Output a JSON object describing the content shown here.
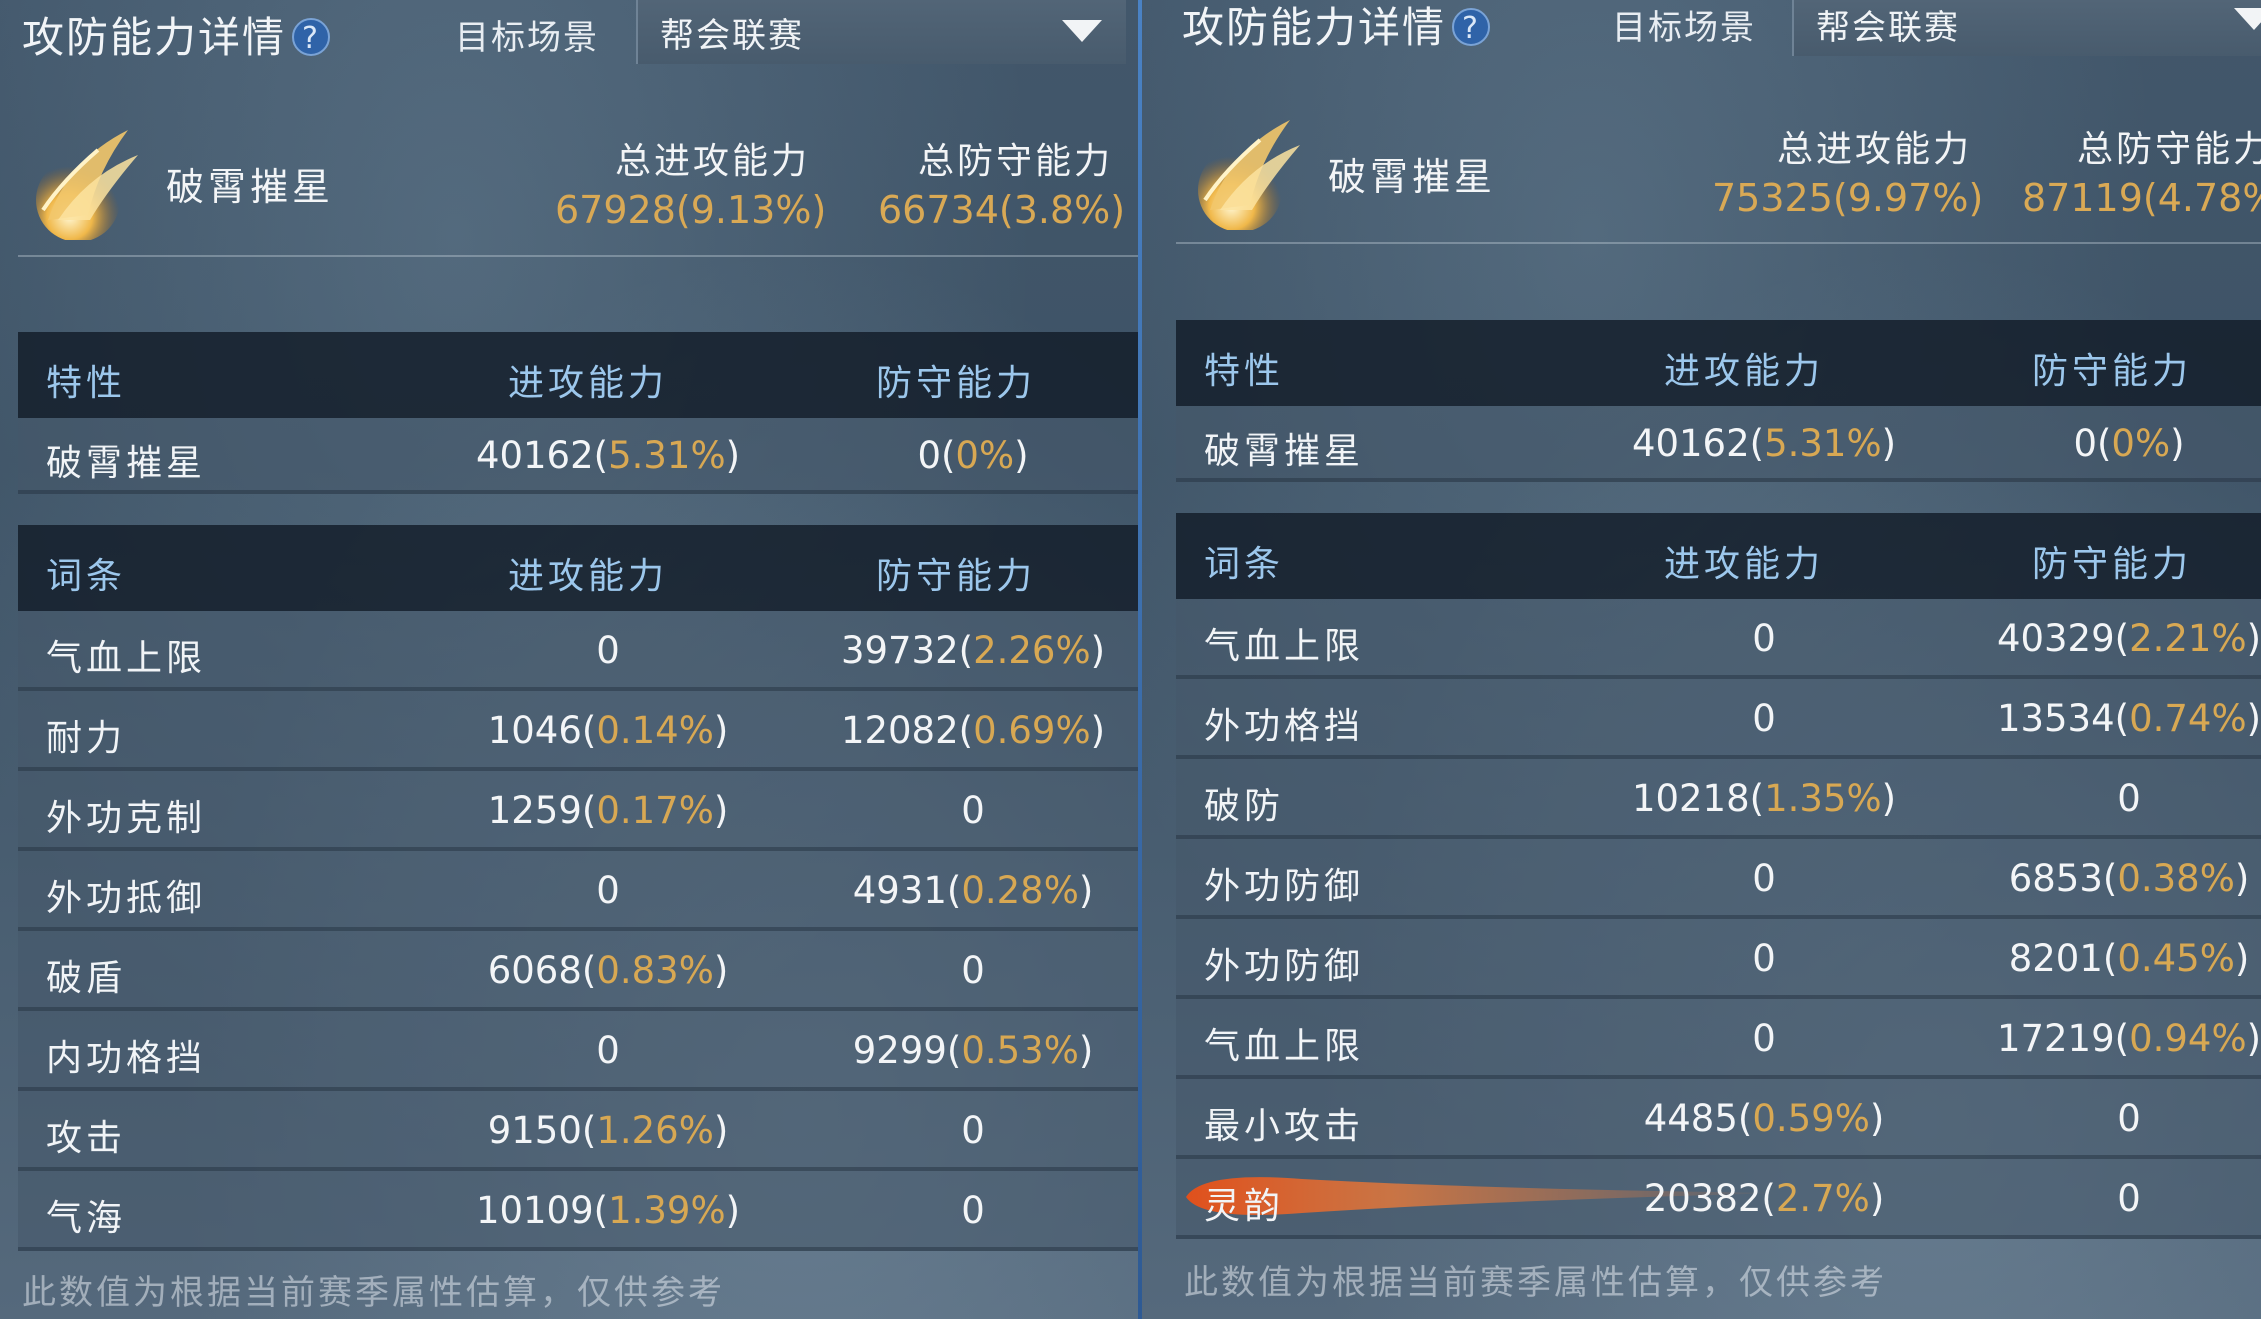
{
  "panels": [
    {
      "title": "攻防能力详情",
      "help_icon": "?",
      "scene_label": "目标场景",
      "scene_value": "帮会联赛",
      "skill_name": "破霄摧星",
      "total_attack_label": "总进攻能力",
      "total_attack_value": "67928(",
      "total_attack_pct": "9.13%",
      "total_defense_label": "总防守能力",
      "total_defense_value": "66734(",
      "total_defense_pct": "3.8%",
      "trait_header": [
        "特性",
        "进攻能力",
        "防守能力"
      ],
      "trait_row": {
        "name": "破霄摧星",
        "atk": "40162(",
        "atk_pct": "5.31%",
        "def": "0(",
        "def_pct": "0%"
      },
      "entry_header": [
        "词条",
        "进攻能力",
        "防守能力"
      ],
      "entries": [
        {
          "name": "气血上限",
          "atk": "0",
          "atk_pct": "",
          "def": "39732(",
          "def_pct": "2.26%"
        },
        {
          "name": "耐力",
          "atk": "1046(",
          "atk_pct": "0.14%",
          "def": "12082(",
          "def_pct": "0.69%"
        },
        {
          "name": "外功克制",
          "atk": "1259(",
          "atk_pct": "0.17%",
          "def": "0",
          "def_pct": ""
        },
        {
          "name": "外功抵御",
          "atk": "0",
          "atk_pct": "",
          "def": "4931(",
          "def_pct": "0.28%"
        },
        {
          "name": "破盾",
          "atk": "6068(",
          "atk_pct": "0.83%",
          "def": "0",
          "def_pct": ""
        },
        {
          "name": "内功格挡",
          "atk": "0",
          "atk_pct": "",
          "def": "9299(",
          "def_pct": "0.53%"
        },
        {
          "name": "攻击",
          "atk": "9150(",
          "atk_pct": "1.26%",
          "def": "0",
          "def_pct": ""
        },
        {
          "name": "气海",
          "atk": "10109(",
          "atk_pct": "1.39%",
          "def": "0",
          "def_pct": ""
        }
      ],
      "footer": "此数值为根据当前赛季属性估算，仅供参考"
    },
    {
      "title": "攻防能力详情",
      "help_icon": "?",
      "scene_label": "目标场景",
      "scene_value": "帮会联赛",
      "skill_name": "破霄摧星",
      "total_attack_label": "总进攻能力",
      "total_attack_value": "75325(",
      "total_attack_pct": "9.97%",
      "total_defense_label": "总防守能力",
      "total_defense_value": "87119(",
      "total_defense_pct": "4.78%",
      "trait_header": [
        "特性",
        "进攻能力",
        "防守能力"
      ],
      "trait_row": {
        "name": "破霄摧星",
        "atk": "40162(",
        "atk_pct": "5.31%",
        "def": "0(",
        "def_pct": "0%"
      },
      "entry_header": [
        "词条",
        "进攻能力",
        "防守能力"
      ],
      "entries": [
        {
          "name": "气血上限",
          "atk": "0",
          "atk_pct": "",
          "def": "40329(",
          "def_pct": "2.21%"
        },
        {
          "name": "外功格挡",
          "atk": "0",
          "atk_pct": "",
          "def": "13534(",
          "def_pct": "0.74%"
        },
        {
          "name": "破防",
          "atk": "10218(",
          "atk_pct": "1.35%",
          "def": "0",
          "def_pct": ""
        },
        {
          "name": "外功防御",
          "atk": "0",
          "atk_pct": "",
          "def": "6853(",
          "def_pct": "0.38%"
        },
        {
          "name": "外功防御",
          "atk": "0",
          "atk_pct": "",
          "def": "8201(",
          "def_pct": "0.45%"
        },
        {
          "name": "气血上限",
          "atk": "0",
          "atk_pct": "",
          "def": "17219(",
          "def_pct": "0.94%"
        },
        {
          "name": "最小攻击",
          "atk": "4485(",
          "atk_pct": "0.59%",
          "def": "0",
          "def_pct": ""
        },
        {
          "name": "灵韵",
          "atk": "20382(",
          "atk_pct": "2.7%",
          "def": "0",
          "def_pct": ""
        }
      ],
      "footer": "此数值为根据当前赛季属性估算，仅供参考"
    }
  ],
  "colors": {
    "accent_gold": "#d8a853",
    "header_text": "#9cc7ec",
    "divider": "#3f78bd"
  },
  "icons": {
    "help": "question-icon",
    "dropdown": "triangle-down-icon",
    "skill": "golden-wing-icon"
  }
}
